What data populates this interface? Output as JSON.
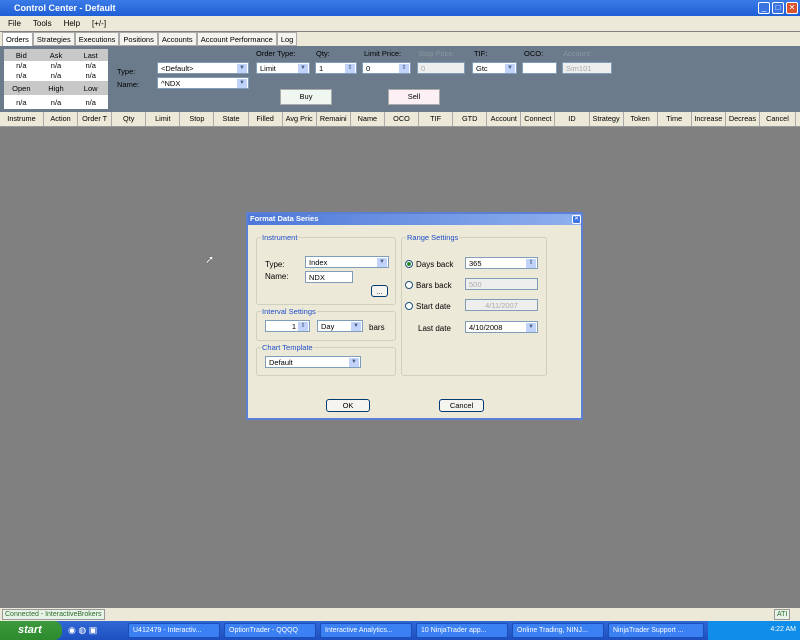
{
  "window": {
    "title": "Control Center - Default"
  },
  "menu": [
    "File",
    "Tools",
    "Help",
    "[+/-]"
  ],
  "tabs": [
    "Orders",
    "Strategies",
    "Executions",
    "Positions",
    "Accounts",
    "Account Performance",
    "Log"
  ],
  "quote": {
    "headers1": [
      "Bid",
      "Ask",
      "Last"
    ],
    "row1": [
      "n/a",
      "n/a",
      "n/a"
    ],
    "row2": [
      "n/a",
      "n/a",
      "n/a"
    ],
    "headers2": [
      "Open",
      "High",
      "Low"
    ],
    "row3": [
      "n/a",
      "n/a",
      "n/a"
    ]
  },
  "order": {
    "type_label": "Type:",
    "type_value": "<Default>",
    "name_label": "Name:",
    "name_value": "^NDX",
    "order_type_label": "Order Type:",
    "order_type_value": "Limit",
    "qty_label": "Qty:",
    "qty_value": "1",
    "limit_label": "Limit Price:",
    "limit_value": "0",
    "stop_label": "Stop Price:",
    "stop_value": "0",
    "tif_label": "TIF:",
    "tif_value": "Gtc",
    "oco_label": "OCO:",
    "oco_value": "",
    "account_label": "Account:",
    "account_value": "Sim101",
    "buy": "Buy",
    "sell": "Sell"
  },
  "grid_columns": [
    "Instrume",
    "Action",
    "Order T",
    "Qty",
    "Limit",
    "Stop",
    "State",
    "Filled",
    "Avg Pric",
    "Remaini",
    "Name",
    "OCO",
    "TIF",
    "GTD",
    "Account",
    "Connect",
    "ID",
    "Strategy",
    "Token",
    "Time",
    "Increase",
    "Decreas",
    "Cancel"
  ],
  "dialog": {
    "title": "Format Data Series",
    "instrument": "Instrument",
    "type_label": "Type:",
    "type_value": "Index",
    "name_label": "Name:",
    "name_value": "NDX",
    "browse": "...",
    "interval": "Interval Settings",
    "interval_value": "1",
    "interval_unit": "Day",
    "bars": "bars",
    "template": "Chart Template",
    "template_value": "Default",
    "range": "Range Settings",
    "days_back": "Days back",
    "days_value": "365",
    "bars_back": "Bars back",
    "bars_value": "500",
    "start_date": "Start date",
    "start_value": "4/11/2007",
    "last_date": "Last date",
    "last_value": "4/10/2008",
    "ok": "OK",
    "cancel": "Cancel"
  },
  "status": {
    "text": "Connected - InteractiveBrokers",
    "right": "ATI"
  },
  "taskbar": {
    "start": "start",
    "items": [
      "U412479 - Interactiv...",
      "OptionTrader - QQQQ",
      "Interactive Analytics...",
      "10 NinjaTrader app...",
      "Online Trading, NINJ...",
      "NinjaTrader Support ..."
    ],
    "clock": "4:22 AM"
  }
}
